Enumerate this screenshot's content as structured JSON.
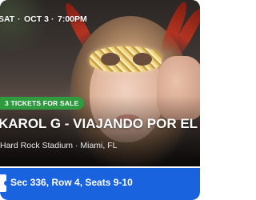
{
  "event": {
    "date_parts": [
      "SAT",
      "OCT 3",
      "7:00PM"
    ],
    "date_separator": "·",
    "badge_label": "3 TICKETS FOR SALE",
    "title": "KAROL G - VIAJANDO POR EL MU...",
    "venue": "Hard Rock Stadium · Miami, FL"
  },
  "seat": {
    "label": "Sec 336, Row 4, Seats 9-10",
    "icon": "ticket-icon"
  },
  "colors": {
    "badge_green": "#2f9a3e",
    "seat_strip_blue": "#1a63df"
  }
}
